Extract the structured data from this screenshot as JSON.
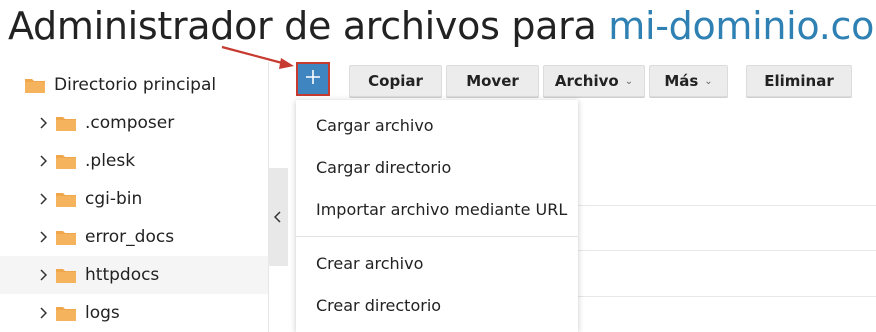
{
  "title": {
    "prefix": "Administrador de archivos para",
    "domain": "mi-dominio.com"
  },
  "colors": {
    "accent_blue": "#3f85c0",
    "domain_blue": "#2f80b3",
    "annotation_red": "#c63a30",
    "folder_orange": "#f0a64a"
  },
  "sidebar": {
    "root": {
      "label": "Directorio principal",
      "icon": "folder-icon"
    },
    "items": [
      {
        "label": ".composer",
        "icon": "folder-icon"
      },
      {
        "label": ".plesk",
        "icon": "folder-icon"
      },
      {
        "label": "cgi-bin",
        "icon": "folder-icon"
      },
      {
        "label": "error_docs",
        "icon": "folder-icon"
      },
      {
        "label": "httpdocs",
        "icon": "folder-icon",
        "selected": true
      },
      {
        "label": "logs",
        "icon": "folder-icon"
      }
    ],
    "collapse_icon": "chevron-left-icon"
  },
  "toolbar": {
    "add_icon": "plus-icon",
    "copy_label": "Copiar",
    "move_label": "Mover",
    "file_label": "Archivo",
    "more_label": "Más",
    "delete_label": "Eliminar"
  },
  "add_menu": {
    "items": [
      "Cargar archivo",
      "Cargar directorio",
      "Importar archivo mediante URL",
      "Crear archivo",
      "Crear directorio"
    ]
  }
}
